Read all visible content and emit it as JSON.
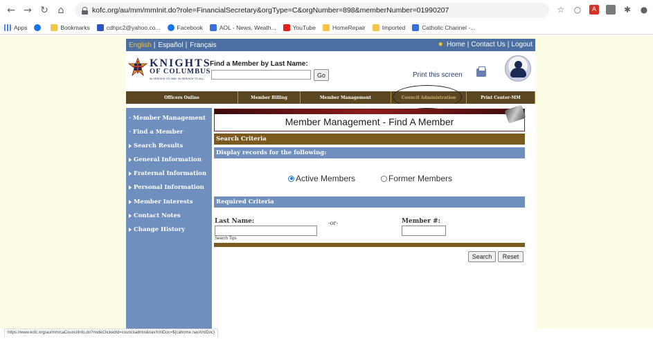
{
  "browser": {
    "url": "kofc.org/au/mm/mmInit.do?role=FinancialSecretary&orgType=C&orgNumber=898&memberNumber=01990207",
    "status_url": "https://www.kofc.org/au/mm/caCouncilInfo.do?nodeClickedId=counciladmin&navXmlDoc=${cahome.navXmlDoc}",
    "nav_icons": [
      "back-arrow-icon",
      "forward-arrow-icon",
      "reload-icon",
      "home-icon"
    ],
    "extension_icons": [
      "star-icon",
      "circle-extension-icon",
      "pdf-extension-icon",
      "extension-icon",
      "puzzle-icon",
      "profile-icon"
    ]
  },
  "bookmarks": [
    {
      "label": "Apps",
      "icon": "apps"
    },
    {
      "label": "",
      "icon": "blue"
    },
    {
      "label": "Bookmarks",
      "icon": "folder"
    },
    {
      "label": "cdhpc2@yahoo.co...",
      "icon": "mail"
    },
    {
      "label": "Facebook",
      "icon": "blue"
    },
    {
      "label": "AOL - News, Weath...",
      "icon": "aol"
    },
    {
      "label": "YouTube",
      "icon": "red"
    },
    {
      "label": "HomeRepair",
      "icon": "folder"
    },
    {
      "label": "Imported",
      "icon": "folder"
    },
    {
      "label": "Catholic Channel -...",
      "icon": "aol"
    }
  ],
  "langbar": {
    "english": "English",
    "espanol": "Español",
    "francais": "Français",
    "separator": "|",
    "home": "Home",
    "contact": "Contact Us",
    "logout": "Logout"
  },
  "header": {
    "logo_name": "KNIGHTS",
    "logo_sub": "OF COLUMBUS",
    "logo_tag": "IN SERVICE TO ONE. IN SERVICE TO ALL.",
    "find_label": "Find a Member by Last Name:",
    "go_label": "Go",
    "print_label": "Print this screen"
  },
  "menu": [
    {
      "label": "Officers Online",
      "width": 162
    },
    {
      "label": "Member Billing",
      "width": 90
    },
    {
      "label": "Member Management",
      "width": 131
    },
    {
      "label": "Council Administration",
      "width": 109
    },
    {
      "label": "Print Center-MM",
      "width": 99
    }
  ],
  "sidebar": {
    "heading": "· Member Management",
    "active": "· Find a Member",
    "items": [
      "Search Results",
      "General Information",
      "Fraternal Information",
      "Personal Information",
      "Member Interests",
      "Contact Notes",
      "Change History"
    ]
  },
  "main": {
    "title": "Member Management - Find A Member",
    "search_criteria": "Search Criteria",
    "display_records": "Display records for the following:",
    "active_members": "Active Members",
    "former_members": "Former Members",
    "required_criteria": "Required Criteria",
    "last_name_label": "Last Name:",
    "or_label": "-or-",
    "member_number_label": "Member #:",
    "search_tips": "Search Tips",
    "search_button": "Search",
    "reset_button": "Reset"
  },
  "colors": {
    "blue_bar": "#6f8fbf",
    "brown_bar": "#7a5a1d",
    "page_bg": "#fdfde5"
  }
}
